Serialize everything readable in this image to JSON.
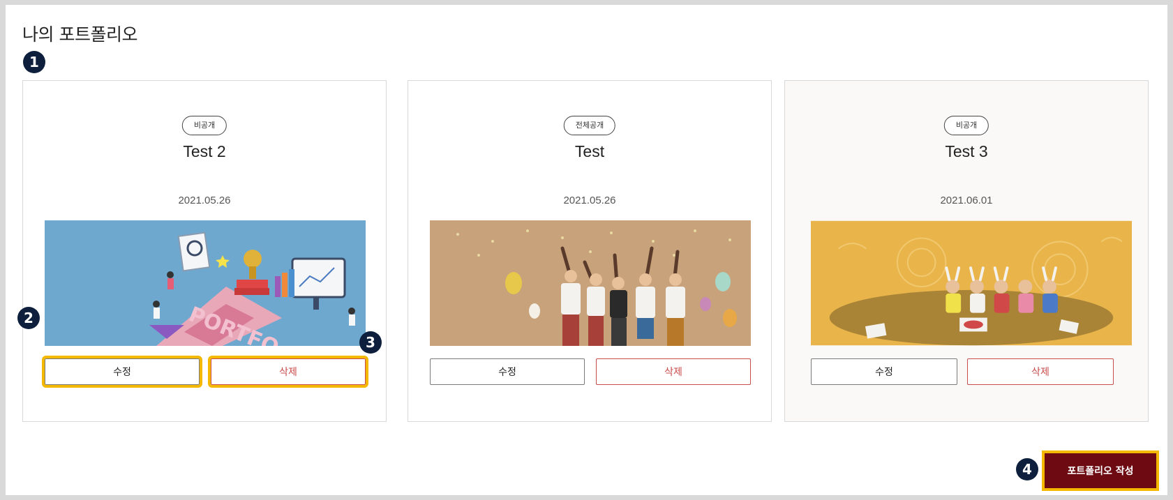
{
  "page": {
    "title": "나의 포트폴리오"
  },
  "markers": [
    "1",
    "2",
    "3",
    "4"
  ],
  "cards": [
    {
      "visibility": "비공개",
      "title": "Test 2",
      "date": "2021.05.26",
      "image": "portfolio-illustration",
      "edit_label": "수정",
      "delete_label": "삭제"
    },
    {
      "visibility": "전체공개",
      "title": "Test",
      "date": "2021.05.26",
      "image": "celebration-illustration",
      "edit_label": "수정",
      "delete_label": "삭제"
    },
    {
      "visibility": "비공개",
      "title": "Test 3",
      "date": "2021.06.01",
      "image": "study-group-illustration",
      "edit_label": "수정",
      "delete_label": "삭제"
    }
  ],
  "actions": {
    "create_label": "포트폴리오 작성"
  },
  "colors": {
    "accent": "#6d0a12",
    "highlight": "#f5b800",
    "delete": "#c94b4b",
    "marker": "#0d1f3c"
  }
}
